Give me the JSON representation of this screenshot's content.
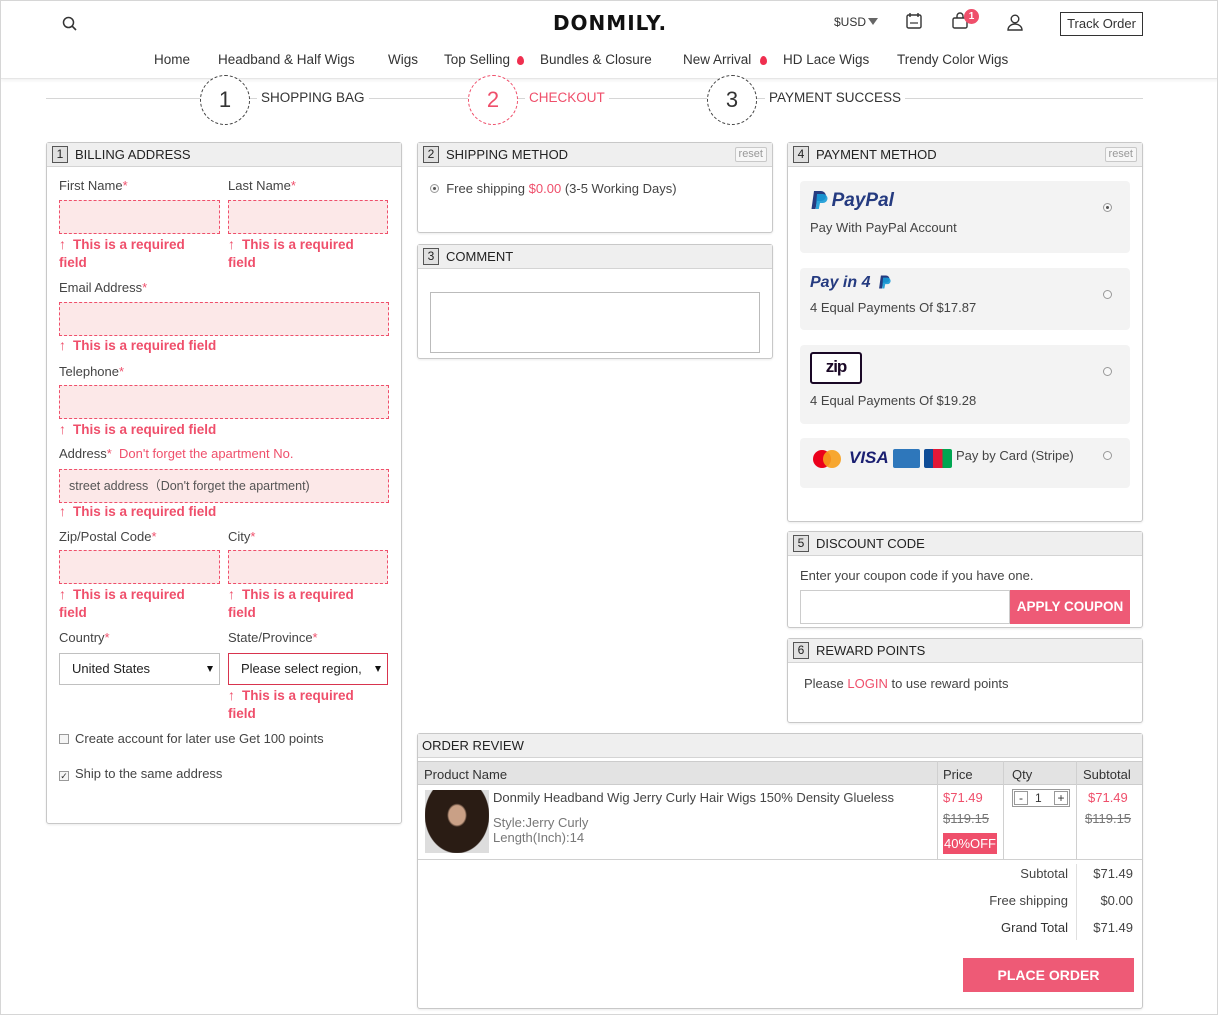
{
  "header": {
    "logo": "DONMILY.",
    "currency": "$USD",
    "cart_count": "1",
    "track_order": "Track Order",
    "icons": [
      "search-icon",
      "calendar-icon",
      "cart-icon",
      "user-icon"
    ]
  },
  "nav": {
    "items": [
      {
        "label": "Home",
        "hot": false
      },
      {
        "label": "Headband & Half Wigs",
        "hot": false
      },
      {
        "label": "Wigs",
        "hot": false
      },
      {
        "label": "Top Selling",
        "hot": true
      },
      {
        "label": "Bundles & Closure",
        "hot": false
      },
      {
        "label": "New Arrival",
        "hot": true
      },
      {
        "label": "HD Lace Wigs",
        "hot": false
      },
      {
        "label": "Trendy Color Wigs",
        "hot": false
      }
    ]
  },
  "steps": [
    {
      "num": "1",
      "label": "SHOPPING BAG",
      "active": false
    },
    {
      "num": "2",
      "label": "CHECKOUT",
      "active": true
    },
    {
      "num": "3",
      "label": "PAYMENT SUCCESS",
      "active": false
    }
  ],
  "billing": {
    "num": "1",
    "title": "BILLING ADDRESS",
    "first_name": "First Name",
    "last_name": "Last Name",
    "email": "Email Address",
    "telephone": "Telephone",
    "address": "Address",
    "address_hint": "Don't forget the apartment No.",
    "address_placeholder": "street address（Don't forget the apartment)",
    "zip": "Zip/Postal Code",
    "city": "City",
    "country": "Country",
    "state": "State/Province",
    "required": "*",
    "err_a": "This is a required",
    "err_b": "field",
    "err_full": "This is a required field",
    "country_value": "United States",
    "state_value": "Please select region,",
    "create_account": "Create account for later use Get 100 points",
    "ship_same": "Ship to the same address"
  },
  "shipping": {
    "num": "2",
    "title": "SHIPPING METHOD",
    "reset": "reset",
    "option": "Free shipping",
    "price": "$0.00",
    "days": "(3-5 Working Days)"
  },
  "comment": {
    "num": "3",
    "title": "COMMENT"
  },
  "payment": {
    "num": "4",
    "title": "PAYMENT METHOD",
    "reset": "reset",
    "paypal_logo": "PayPal",
    "paypal_desc": "Pay With PayPal Account",
    "payin4_logo": "Pay in 4",
    "payin4_desc": "4 Equal Payments Of $17.87",
    "zip_logo": "zip",
    "zip_desc": "4 Equal Payments Of $19.28",
    "visa": "VISA",
    "card_desc": "Pay by Card (Stripe)",
    "selected": "paypal"
  },
  "discount": {
    "num": "5",
    "title": "DISCOUNT CODE",
    "prompt": "Enter your coupon code if you have one.",
    "button": "APPLY COUPON"
  },
  "reward": {
    "num": "6",
    "title": "REWARD POINTS",
    "pre": "Please",
    "link": "LOGIN",
    "post": "to use reward points"
  },
  "order": {
    "title": "ORDER REVIEW",
    "columns": [
      "Product Name",
      "Price",
      "Qty",
      "Subtotal"
    ],
    "item": {
      "name": "Donmily Headband Wig Jerry Curly Hair Wigs 150% Density Glueless",
      "style": "Style:Jerry Curly",
      "length": "Length(Inch):14",
      "price": "$71.49",
      "old_price": "$119.15",
      "discount": "40%OFF",
      "qty": "1",
      "minus": "-",
      "plus": "+",
      "subtotal": "$71.49",
      "old_subtotal": "$119.15"
    },
    "subtotal_label": "Subtotal",
    "subtotal": "$71.49",
    "shipping_label": "Free shipping",
    "shipping": "$0.00",
    "grand_label": "Grand Total",
    "grand": "$71.49",
    "place_order": "PLACE ORDER"
  },
  "colors": {
    "accent": "#ef4f6b",
    "button": "#ee5a76"
  }
}
